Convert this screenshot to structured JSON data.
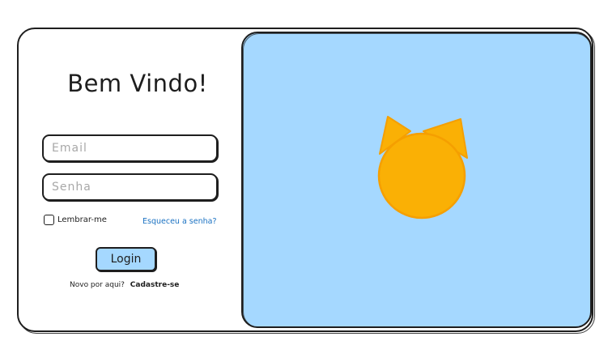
{
  "login": {
    "title": "Bem Vindo!",
    "email_placeholder": "Email",
    "password_placeholder": "Senha",
    "remember_label": "Lembrar-me",
    "forgot_label": "Esqueceu a senha?",
    "login_button": "Login",
    "signup_prompt": "Novo por aqui?",
    "signup_label": "Cadastre-se"
  },
  "hero": {
    "logo_icon": "cat-icon",
    "background_color": "#a5d8ff",
    "logo_color": "#fab005",
    "logo_stroke_color": "#f59f00"
  },
  "colors": {
    "accent": "#a5d8ff",
    "link": "#1971c2",
    "stroke": "#1e1e1e"
  }
}
